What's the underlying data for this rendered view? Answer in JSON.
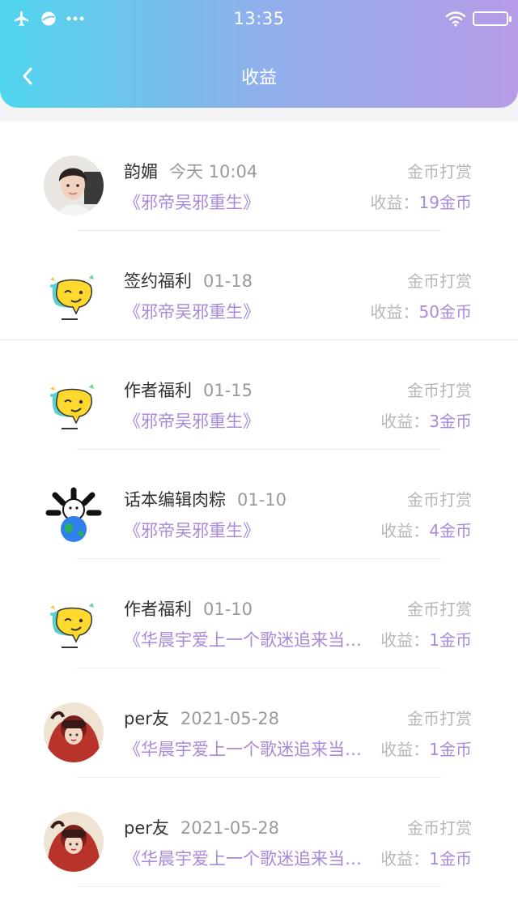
{
  "status_bar": {
    "time": "13:35",
    "icons": [
      "airplane-mode-icon",
      "app-notification-icon",
      "more-dots-icon",
      "wifi-icon",
      "battery-icon"
    ]
  },
  "nav": {
    "title": "收益",
    "back_icon": "chevron-left-icon"
  },
  "colors": {
    "accent_purple": "#a98ad8",
    "gradient_start": "#4fd6ee",
    "gradient_end": "#b69be6"
  },
  "income_label": "收益：",
  "records": [
    {
      "name": "韵媚",
      "time": "今天 10:04",
      "type": "金币打赏",
      "book": "《邪帝吴邪重生》",
      "amount": "19金币",
      "avatar": "photo-avatar"
    },
    {
      "name": "签约福利",
      "time": "01-18",
      "type": "金币打赏",
      "book": "《邪帝吴邪重生》",
      "amount": "50金币",
      "avatar": "emoji-sticker-avatar"
    },
    {
      "name": "作者福利",
      "time": "01-15",
      "type": "金币打赏",
      "book": "《邪帝吴邪重生》",
      "amount": "3金币",
      "avatar": "emoji-sticker-avatar"
    },
    {
      "name": "话本编辑肉粽",
      "time": "01-10",
      "type": "金币打赏",
      "book": "《邪帝吴邪重生》",
      "amount": "4金币",
      "avatar": "globe-bones-avatar"
    },
    {
      "name": "作者福利",
      "time": "01-10",
      "type": "金币打赏",
      "book": "《华晨宇爱上一个歌迷追来当…",
      "amount": "1金币",
      "avatar": "emoji-sticker-avatar"
    },
    {
      "name": "per友",
      "time": "2021-05-28",
      "type": "金币打赏",
      "book": "《华晨宇爱上一个歌迷追来当…",
      "amount": "1金币",
      "avatar": "red-girl-avatar"
    },
    {
      "name": "per友",
      "time": "2021-05-28",
      "type": "金币打赏",
      "book": "《华晨宇爱上一个歌迷追来当…",
      "amount": "1金币",
      "avatar": "red-girl-avatar"
    }
  ]
}
